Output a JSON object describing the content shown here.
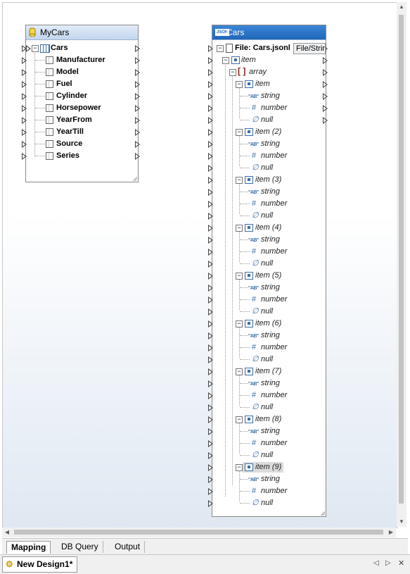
{
  "components": {
    "db": {
      "title": "MyCars",
      "root": "Cars",
      "fields": [
        "Manufacturer",
        "Model",
        "Fuel",
        "Cylinder",
        "Horsepower",
        "YearFrom",
        "YearTill",
        "Source",
        "Series"
      ]
    },
    "json": {
      "badge": "JSON",
      "title": "Cars",
      "file_label": "File: Cars.jsonl",
      "file_button": "File/String",
      "root_item": "item",
      "array": "array",
      "items": [
        "item",
        "item (2)",
        "item (3)",
        "item (4)",
        "item (5)",
        "item (6)",
        "item (7)",
        "item (8)",
        "item (9)"
      ],
      "types": {
        "string": "string",
        "number": "number",
        "null": "null"
      },
      "string_glyph": "\"AB\"",
      "number_glyph": "#",
      "null_glyph": "∅"
    }
  },
  "tabs": [
    {
      "label": "Mapping",
      "active": true
    },
    {
      "label": "DB Query",
      "active": false
    },
    {
      "label": "Output",
      "active": false
    }
  ],
  "document": {
    "tab_label": "New Design1*"
  },
  "colors": {
    "json_header": "#1f67b8",
    "db_header": "#c3d6ee",
    "canvas_bottom": "#dfe8f2"
  }
}
